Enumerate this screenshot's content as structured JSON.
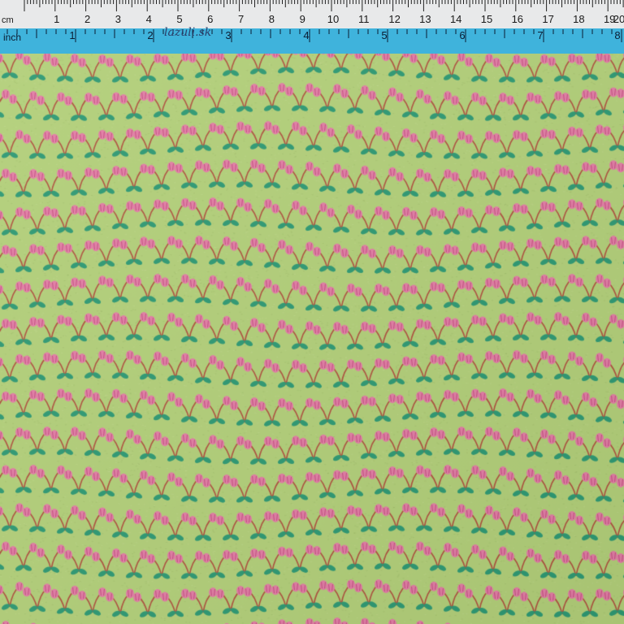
{
  "photo": {
    "subject": "green cotton fabric swatch with pink tulip print beside a measuring ruler",
    "colors": {
      "fabric": "#b3d07a",
      "stem": "#b0513f",
      "leaf": "#2f9a74",
      "flower": "#e37fa6",
      "flower_dark": "#c75383",
      "ruler_top": "#e8e9ea",
      "ruler_band": "#3fb3dc"
    }
  },
  "ruler": {
    "cm_unit_label": "cm",
    "cm_numbers": [
      "1",
      "2",
      "3",
      "4",
      "5",
      "6",
      "7",
      "8",
      "9",
      "10",
      "11",
      "12",
      "13",
      "14",
      "15",
      "16",
      "17",
      "18",
      "19",
      "20"
    ],
    "inch_unit_label": "inch",
    "inch_numbers": [
      "1",
      "2",
      "3",
      "4",
      "5",
      "6",
      "7",
      "8"
    ],
    "brand": "lazuli.sk"
  }
}
